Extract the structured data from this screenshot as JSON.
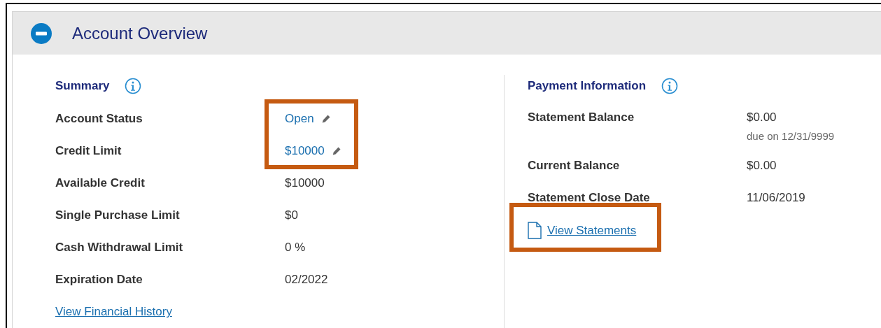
{
  "header": {
    "title": "Account Overview",
    "expanded": true
  },
  "summary": {
    "title": "Summary",
    "rows": [
      {
        "label": "Account Status",
        "value": "Open",
        "kind": "editable",
        "highlighted": true
      },
      {
        "label": "Credit Limit",
        "value": "$10000",
        "kind": "editable",
        "highlighted": true
      },
      {
        "label": "Available Credit",
        "value": "$10000",
        "kind": "text",
        "highlighted": false
      },
      {
        "label": "Single Purchase Limit",
        "value": "$0",
        "kind": "text",
        "highlighted": false
      },
      {
        "label": "Cash Withdrawal Limit",
        "value": "0 %",
        "kind": "text",
        "highlighted": false
      },
      {
        "label": "Expiration Date",
        "value": "02/2022",
        "kind": "text",
        "highlighted": false
      }
    ],
    "link": {
      "text": "View Financial History",
      "highlighted": false
    }
  },
  "payment": {
    "title": "Payment Information",
    "rows": [
      {
        "label": "Statement Balance",
        "value": "$0.00",
        "note": "due on 12/31/9999"
      },
      {
        "label": "Current Balance",
        "value": "$0.00"
      },
      {
        "label": "Statement Close Date",
        "value": "11/06/2019"
      }
    ],
    "link": {
      "text": "View Statements",
      "highlighted": true
    }
  }
}
